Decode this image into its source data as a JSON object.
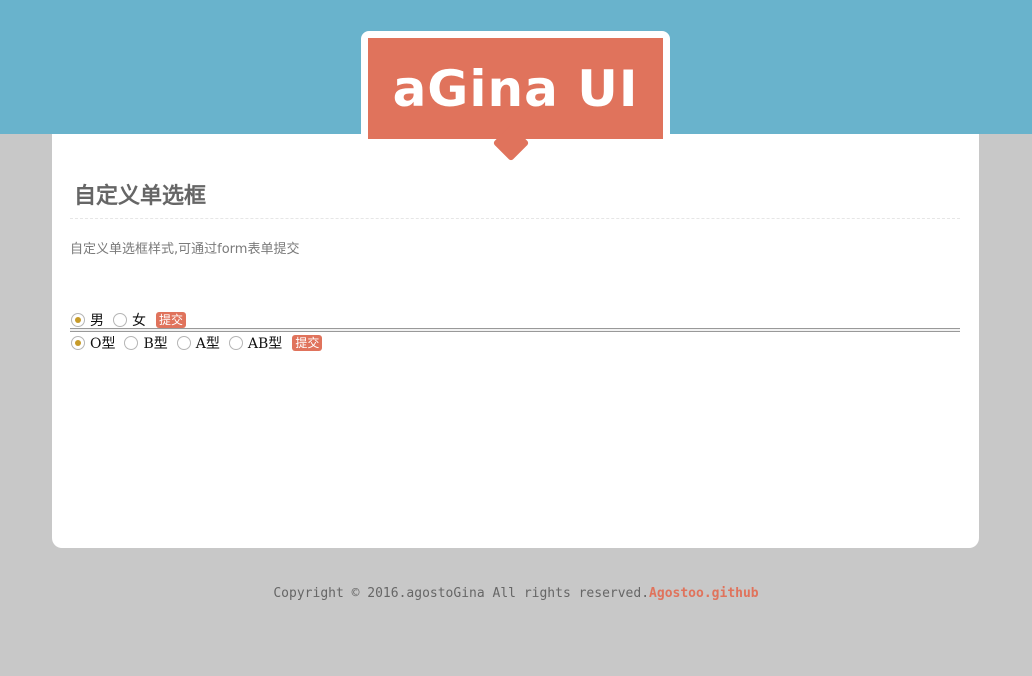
{
  "header": {
    "logo_text": "aGina UI"
  },
  "section": {
    "title": "自定义单选框",
    "description": "自定义单选框样式,可通过form表单提交"
  },
  "form1": {
    "options": [
      "男",
      "女"
    ],
    "checked_index": 0,
    "submit_label": "提交"
  },
  "form2": {
    "options": [
      "O型",
      "B型",
      "A型",
      "AB型"
    ],
    "checked_index": 0,
    "submit_label": "提交"
  },
  "footer": {
    "copyright": "Copyright © 2016.agostoGina All rights reserved.",
    "link_text": "Agostoo.github"
  },
  "colors": {
    "header_bg": "#69b3cc",
    "accent": "#e0735c",
    "radio_dot": "#c79b2a",
    "page_bg": "#c8c8c8"
  }
}
